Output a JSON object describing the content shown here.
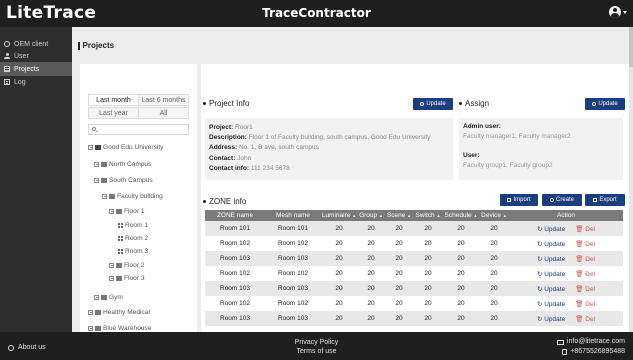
{
  "header": {
    "logo": "LiteTrace",
    "title": "TraceContractor"
  },
  "sidebar": {
    "items": [
      {
        "label": "OEM client",
        "icon": "gear-icon"
      },
      {
        "label": "User",
        "icon": "user-icon"
      },
      {
        "label": "Projects",
        "icon": "projects-icon",
        "active": true
      },
      {
        "label": "Log",
        "icon": "log-icon"
      }
    ]
  },
  "page": {
    "title": "Projects"
  },
  "filters": {
    "last_month": "Last month",
    "last_6_months": "Last  6 months",
    "last_year": "Last year",
    "all": "All",
    "search_placeholder": ""
  },
  "tree": {
    "good_edu": "Good Edu University",
    "north_campus": "North Campus",
    "south_campus": "South Campus",
    "faculty_building": "Faculty building",
    "floor1": "Floor 1",
    "room1": "Room 1",
    "room2": "Room 2",
    "room3": "Room 3",
    "floor2": "Floor 2",
    "floor3": "Floor 3",
    "gym": "Gym",
    "healthy_medical": "Healthy Medical",
    "blue_warehouse": "Blue Warehouse"
  },
  "project_info": {
    "section_title": "Project Info",
    "update_label": "Update",
    "project_key": "Project",
    "project_value": "Roor1",
    "description_key": "Description",
    "description_value": "Floor 1 of Faculty building, south campus, Good Edu University",
    "address_key": "Address",
    "address_value": "No. 1, B ave, south campus",
    "contact_key": "Contact",
    "contact_value": "John",
    "contact_info_key": "Contact info",
    "contact_info_value": "111 234 5678"
  },
  "assign": {
    "section_title": "Assign",
    "update_label": "Update",
    "admin_user_label": "Admin user:",
    "admin_user_value": "Faculty manager1, Faculty manager2",
    "user_label": "User:",
    "user_value": "Faculty group1, Faculty group2"
  },
  "zone_info": {
    "section_title": "ZONE info",
    "import_label": "Import",
    "create_label": "Create",
    "export_label": "Export",
    "columns": [
      "ZONE name",
      "Mesh name",
      "Luminaire",
      "Group",
      "Scene",
      "Switch",
      "Schedule",
      "Device",
      "Action"
    ],
    "update_label": "Update",
    "del_label": "Del",
    "rows": [
      [
        "Room 101",
        "Room 101",
        "20",
        "20",
        "20",
        "20",
        "20",
        "20"
      ],
      [
        "Room 102",
        "Room 102",
        "20",
        "20",
        "20",
        "20",
        "20",
        "20"
      ],
      [
        "Room 103",
        "Room 103",
        "20",
        "20",
        "20",
        "20",
        "20",
        "20"
      ],
      [
        "Room 102",
        "Room 102",
        "20",
        "20",
        "20",
        "20",
        "20",
        "20"
      ],
      [
        "Room 103",
        "Room 103",
        "20",
        "20",
        "20",
        "20",
        "20",
        "20"
      ],
      [
        "Room 102",
        "Room 102",
        "20",
        "20",
        "20",
        "20",
        "20",
        "20"
      ],
      [
        "Room 103",
        "Room 103",
        "20",
        "20",
        "20",
        "20",
        "20",
        "20"
      ]
    ]
  },
  "footer": {
    "about": "About us",
    "privacy": "Privacy Policy",
    "terms": "Terms of use",
    "email": "info@litetrace.com",
    "phone": "+8675526895488"
  }
}
